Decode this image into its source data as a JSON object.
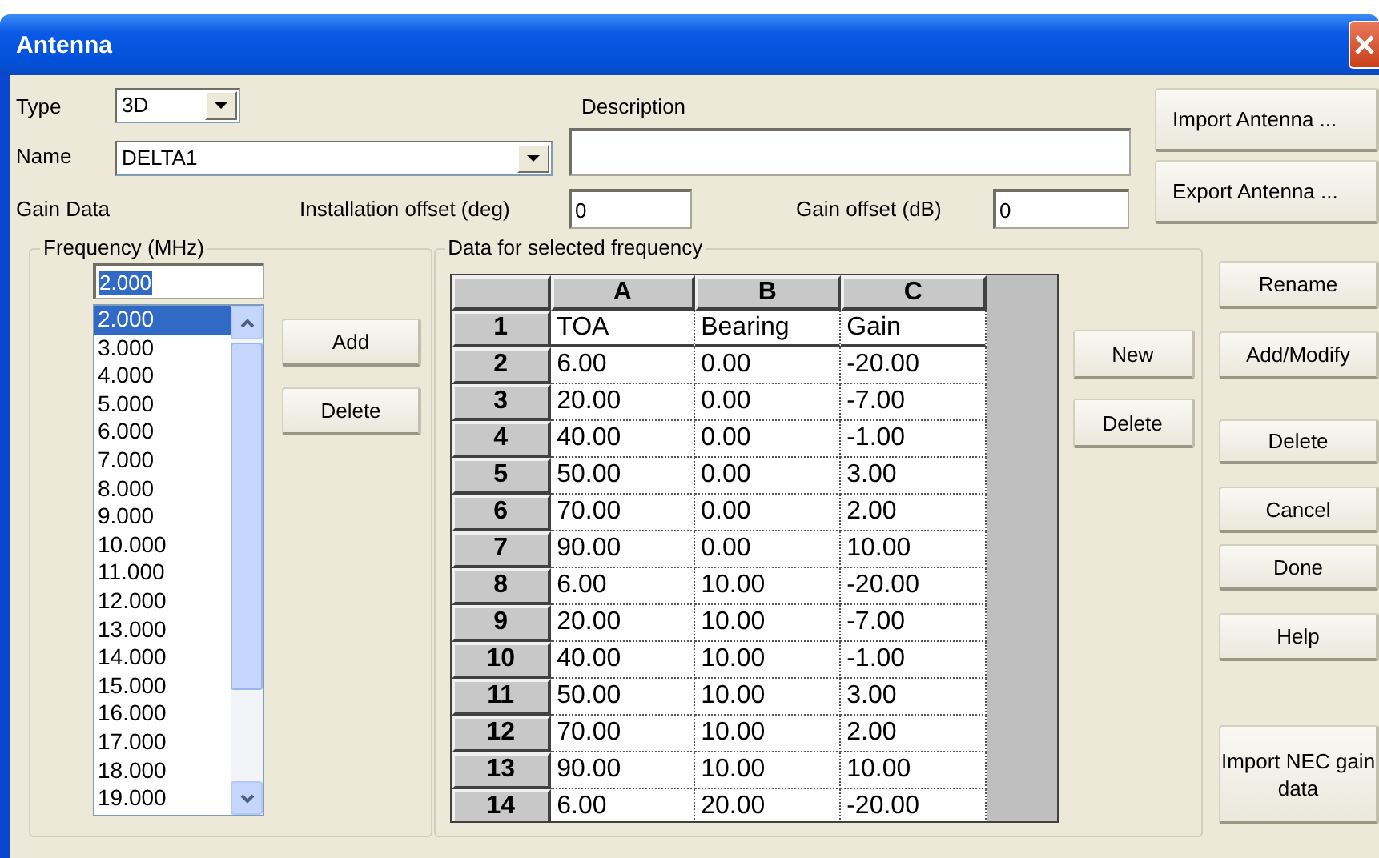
{
  "window": {
    "title": "Antenna"
  },
  "type": {
    "label": "Type",
    "value": "3D"
  },
  "name": {
    "label": "Name",
    "value": "DELTA1"
  },
  "description": {
    "label": "Description"
  },
  "gain_data_label": "Gain Data",
  "installation_offset": {
    "label": "Installation offset (deg)",
    "value": "0"
  },
  "gain_offset": {
    "label": "Gain offset (dB)",
    "value": "0"
  },
  "top_buttons": [
    "Import Antenna ...",
    "Export Antenna ..."
  ],
  "frequency": {
    "title": "Frequency (MHz)",
    "input": "2.000",
    "buttons": [
      "Add",
      "Delete"
    ],
    "items": [
      {
        "label": "2.000",
        "selected": true
      },
      {
        "label": "3.000",
        "selected": false
      },
      {
        "label": "4.000",
        "selected": false
      },
      {
        "label": "5.000",
        "selected": false
      },
      {
        "label": "6.000",
        "selected": false
      },
      {
        "label": "7.000",
        "selected": false
      },
      {
        "label": "8.000",
        "selected": false
      },
      {
        "label": "9.000",
        "selected": false
      },
      {
        "label": "10.000",
        "selected": false
      },
      {
        "label": "11.000",
        "selected": false
      },
      {
        "label": "12.000",
        "selected": false
      },
      {
        "label": "13.000",
        "selected": false
      },
      {
        "label": "14.000",
        "selected": false
      },
      {
        "label": "15.000",
        "selected": false
      },
      {
        "label": "16.000",
        "selected": false
      },
      {
        "label": "17.000",
        "selected": false
      },
      {
        "label": "18.000",
        "selected": false
      },
      {
        "label": "19.000",
        "selected": false
      }
    ]
  },
  "grid": {
    "title": "Data for selected frequency",
    "columns": [
      "A",
      "B",
      "C"
    ],
    "buttons": [
      "New",
      "Delete"
    ],
    "rows": [
      {
        "header": "1",
        "cells": [
          "TOA",
          "Bearing",
          "Gain"
        ]
      },
      {
        "header": "2",
        "cells": [
          "6.00",
          "0.00",
          "-20.00"
        ]
      },
      {
        "header": "3",
        "cells": [
          "20.00",
          "0.00",
          "-7.00"
        ]
      },
      {
        "header": "4",
        "cells": [
          "40.00",
          "0.00",
          "-1.00"
        ]
      },
      {
        "header": "5",
        "cells": [
          "50.00",
          "0.00",
          "3.00"
        ]
      },
      {
        "header": "6",
        "cells": [
          "70.00",
          "0.00",
          "2.00"
        ]
      },
      {
        "header": "7",
        "cells": [
          "90.00",
          "0.00",
          "10.00"
        ]
      },
      {
        "header": "8",
        "cells": [
          "6.00",
          "10.00",
          "-20.00"
        ]
      },
      {
        "header": "9",
        "cells": [
          "20.00",
          "10.00",
          "-7.00"
        ]
      },
      {
        "header": "10",
        "cells": [
          "40.00",
          "10.00",
          "-1.00"
        ]
      },
      {
        "header": "11",
        "cells": [
          "50.00",
          "10.00",
          "3.00"
        ]
      },
      {
        "header": "12",
        "cells": [
          "70.00",
          "10.00",
          "2.00"
        ]
      },
      {
        "header": "13",
        "cells": [
          "90.00",
          "10.00",
          "10.00"
        ]
      },
      {
        "header": "14",
        "cells": [
          "6.00",
          "20.00",
          "-20.00"
        ]
      }
    ]
  },
  "side_buttons": [
    "Rename",
    "Add/Modify",
    "Delete",
    "Cancel",
    "Done",
    "Help",
    "Import NEC gain data"
  ]
}
